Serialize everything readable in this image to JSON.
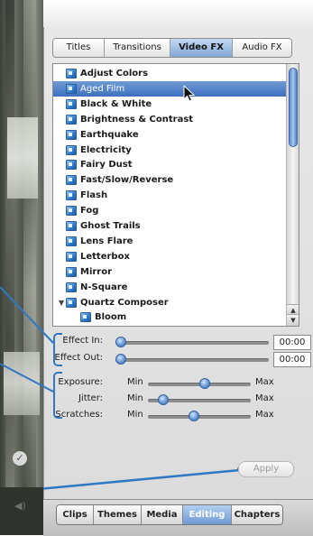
{
  "tabs": [
    {
      "label": "Titles",
      "active": false
    },
    {
      "label": "Transitions",
      "active": false
    },
    {
      "label": "Video FX",
      "active": true
    },
    {
      "label": "Audio FX",
      "active": false
    }
  ],
  "effects_list": [
    {
      "label": "Adjust Colors",
      "selected": false
    },
    {
      "label": "Aged Film",
      "selected": true
    },
    {
      "label": "Black & White",
      "selected": false
    },
    {
      "label": "Brightness & Contrast",
      "selected": false
    },
    {
      "label": "Earthquake",
      "selected": false
    },
    {
      "label": "Electricity",
      "selected": false
    },
    {
      "label": "Fairy Dust",
      "selected": false
    },
    {
      "label": "Fast/Slow/Reverse",
      "selected": false
    },
    {
      "label": "Flash",
      "selected": false
    },
    {
      "label": "Fog",
      "selected": false
    },
    {
      "label": "Ghost Trails",
      "selected": false
    },
    {
      "label": "Lens Flare",
      "selected": false
    },
    {
      "label": "Letterbox",
      "selected": false
    },
    {
      "label": "Mirror",
      "selected": false
    },
    {
      "label": "N-Square",
      "selected": false
    },
    {
      "label": "Quartz Composer",
      "selected": false,
      "expanded": true
    },
    {
      "label": "Bloom",
      "selected": false,
      "child": true
    }
  ],
  "effect_in": {
    "label": "Effect In:",
    "value": "00:00",
    "level": 0.0
  },
  "effect_out": {
    "label": "Effect Out:",
    "value": "00:00",
    "level": 0.0
  },
  "params": [
    {
      "label": "Exposure:",
      "min": "Min",
      "max": "Max",
      "level": 0.55
    },
    {
      "label": "Jitter:",
      "min": "Min",
      "max": "Max",
      "level": 0.15
    },
    {
      "label": "Scratches:",
      "min": "Min",
      "max": "Max",
      "level": 0.45
    }
  ],
  "apply_label": "Apply",
  "bottom_tabs": [
    {
      "label": "Clips",
      "active": false
    },
    {
      "label": "Themes",
      "active": false
    },
    {
      "label": "Media",
      "active": false
    },
    {
      "label": "Editing",
      "active": true
    },
    {
      "label": "Chapters",
      "active": false
    }
  ],
  "colors": {
    "accent": "#3e70bf",
    "callout": "#2f78c4"
  }
}
